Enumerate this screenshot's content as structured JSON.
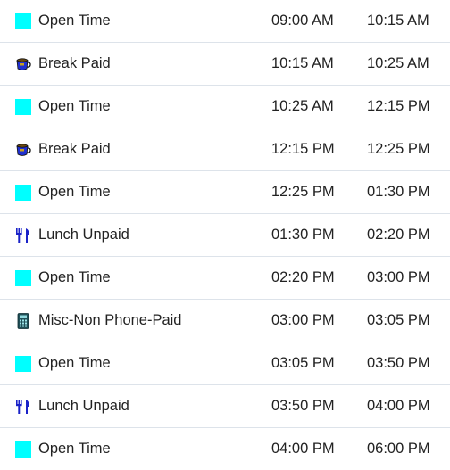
{
  "schedule": {
    "rows": [
      {
        "activity": "Open Time",
        "icon": "open-time-icon",
        "start": "09:00 AM",
        "end": "10:15 AM"
      },
      {
        "activity": "Break Paid",
        "icon": "coffee-cup-icon",
        "start": "10:15 AM",
        "end": "10:25 AM"
      },
      {
        "activity": "Open Time",
        "icon": "open-time-icon",
        "start": "10:25 AM",
        "end": "12:15 PM"
      },
      {
        "activity": "Break Paid",
        "icon": "coffee-cup-icon",
        "start": "12:15 PM",
        "end": "12:25 PM"
      },
      {
        "activity": "Open Time",
        "icon": "open-time-icon",
        "start": "12:25 PM",
        "end": "01:30 PM"
      },
      {
        "activity": "Lunch Unpaid",
        "icon": "fork-knife-icon",
        "start": "01:30 PM",
        "end": "02:20 PM"
      },
      {
        "activity": "Open Time",
        "icon": "open-time-icon",
        "start": "02:20 PM",
        "end": "03:00 PM"
      },
      {
        "activity": "Misc-Non Phone-Paid",
        "icon": "calculator-icon",
        "start": "03:00 PM",
        "end": "03:05 PM"
      },
      {
        "activity": "Open Time",
        "icon": "open-time-icon",
        "start": "03:05 PM",
        "end": "03:50 PM"
      },
      {
        "activity": "Lunch Unpaid",
        "icon": "fork-knife-icon",
        "start": "03:50 PM",
        "end": "04:00 PM"
      },
      {
        "activity": "Open Time",
        "icon": "open-time-icon",
        "start": "04:00 PM",
        "end": "06:00 PM"
      }
    ]
  },
  "colors": {
    "open_time": "#00ffff",
    "text": "#222222",
    "divider": "#dde3ea"
  }
}
